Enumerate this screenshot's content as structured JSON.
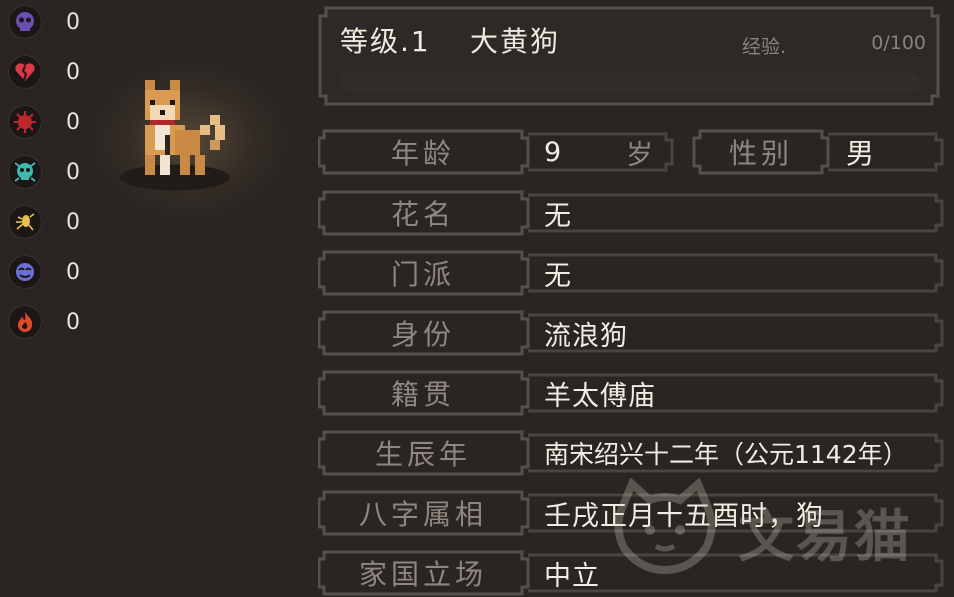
{
  "status_effects": [
    {
      "icon": "purple-skull-icon",
      "color": "#6a4fb3",
      "count": "0"
    },
    {
      "icon": "broken-heart-icon",
      "color": "#d83a4a",
      "count": "0"
    },
    {
      "icon": "red-virus-icon",
      "color": "#c0262e",
      "count": "0"
    },
    {
      "icon": "teal-skull-icon",
      "color": "#3fb8b0",
      "count": "0"
    },
    {
      "icon": "yellow-bug-icon",
      "color": "#e6c24a",
      "count": "0"
    },
    {
      "icon": "blue-face-icon",
      "color": "#6c6fd9",
      "count": "0"
    },
    {
      "icon": "fire-icon",
      "color": "#e04a2a",
      "count": "0"
    }
  ],
  "level_panel": {
    "level_text": "等级.1",
    "pet_name": "大黄狗",
    "exp_label": "经验.",
    "exp_value": "0/100",
    "exp_progress": 0
  },
  "info": {
    "age": {
      "label": "年龄",
      "value": "9",
      "unit": "岁"
    },
    "gender": {
      "label": "性别",
      "value": "男"
    },
    "rows": [
      {
        "label": "花名",
        "value": "无"
      },
      {
        "label": "门派",
        "value": "无"
      },
      {
        "label": "身份",
        "value": "流浪狗"
      },
      {
        "label": "籍贯",
        "value": "羊太傅庙"
      },
      {
        "label": "生辰年",
        "value": "南宋绍兴十二年（公元1142年）"
      },
      {
        "label": "八字属相",
        "value": "壬戌正月十五酉时，狗"
      },
      {
        "label": "家国立场",
        "value": "中立"
      }
    ]
  },
  "watermark": {
    "text": "文易猫"
  },
  "colors": {
    "frame": "#4a4440",
    "frame_light": "#5c5550",
    "background": "#2a2522"
  }
}
